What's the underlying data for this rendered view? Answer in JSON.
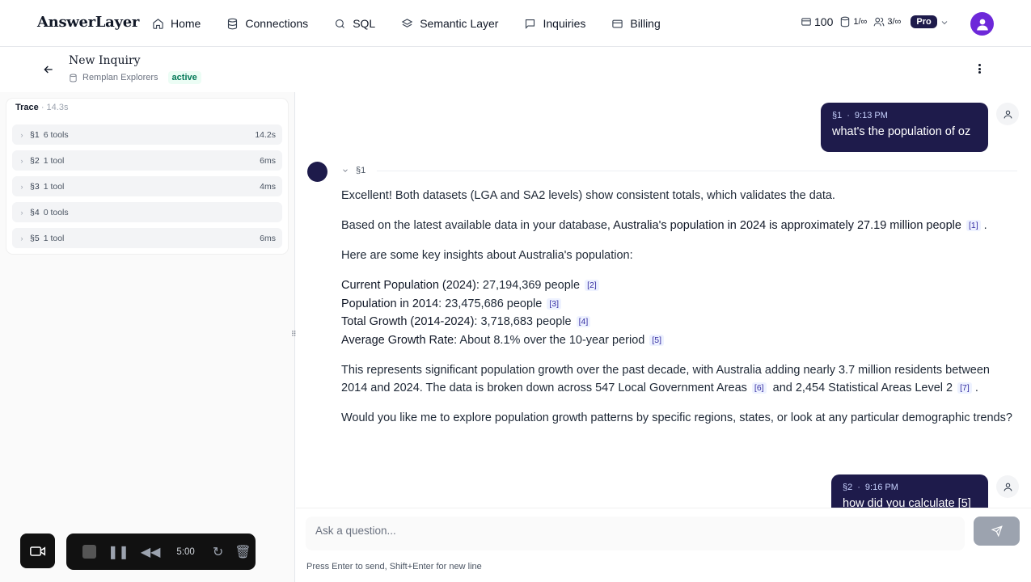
{
  "app": {
    "logo": "AnswerLayer"
  },
  "nav": [
    {
      "label": "Home",
      "icon": "home-icon"
    },
    {
      "label": "Connections",
      "icon": "database-icon"
    },
    {
      "label": "SQL",
      "icon": "search-icon"
    },
    {
      "label": "Semantic Layer",
      "icon": "layers-icon"
    },
    {
      "label": "Inquiries",
      "icon": "message-square-icon"
    },
    {
      "label": "Billing",
      "icon": "credit-card-icon"
    }
  ],
  "stats": {
    "credits": "100",
    "connections": "1/∞",
    "users": "3/∞",
    "plan": "Pro"
  },
  "inquiry": {
    "title": "New Inquiry",
    "workspace": "Remplan Explorers",
    "status": "active"
  },
  "trace": {
    "label": "Trace",
    "total": "· 14.3s",
    "rows": [
      {
        "section": "§1",
        "tools": "6 tools",
        "duration": "14.2s"
      },
      {
        "section": "§2",
        "tools": "1 tool",
        "duration": "6ms"
      },
      {
        "section": "§3",
        "tools": "1 tool",
        "duration": "4ms"
      },
      {
        "section": "§4",
        "tools": "0 tools",
        "duration": ""
      },
      {
        "section": "§5",
        "tools": "1 tool",
        "duration": "6ms"
      }
    ]
  },
  "messages": {
    "m1": {
      "section": "§1",
      "sep": "·",
      "time": "9:13 PM",
      "text": "what's the population of oz"
    },
    "a1": {
      "section": "§1",
      "p1": "Excellent! Both datasets (LGA and SA2 levels) show consistent totals, which validates the data.",
      "p2_pre": "Based on the latest available data in your database,",
      "p2_bold": "Australia's population in 2024 is approximately 27.19 million people",
      "c1": "[1]",
      "p2_end": ".",
      "p3": "Here are some key insights about Australia's population:",
      "l1_label": "Current Population (2024)",
      "l1_value": ": 27,194,369 people",
      "c2": "[2]",
      "l2_label": "Population in 2014",
      "l2_value": ": 23,475,686 people",
      "c3": "[3]",
      "l3_label": "Total Growth (2014-2024)",
      "l3_value": ": 3,718,683 people",
      "c4": "[4]",
      "l4_label": "Average Growth Rate",
      "l4_value": ": About 8.1% over the 10-year period",
      "c5": "[5]",
      "p4_a": "This represents significant population growth over the past decade, with Australia adding nearly 3.7 million residents between 2014 and 2024. The data is broken down across 547 Local Government Areas",
      "c6": "[6]",
      "p4_b": "and 2,454 Statistical Areas Level 2",
      "c7": "[7]",
      "p4_end": ".",
      "p5": "Would you like me to explore population growth patterns by specific regions, states, or look at any particular demographic trends?"
    },
    "m2": {
      "section": "§2",
      "sep": "·",
      "time": "9:16 PM",
      "text": "how did you calculate [5]"
    }
  },
  "composer": {
    "placeholder": "Ask a question...",
    "hint": "Press Enter to send, Shift+Enter for new line"
  },
  "recorder": {
    "time": "5:00"
  }
}
